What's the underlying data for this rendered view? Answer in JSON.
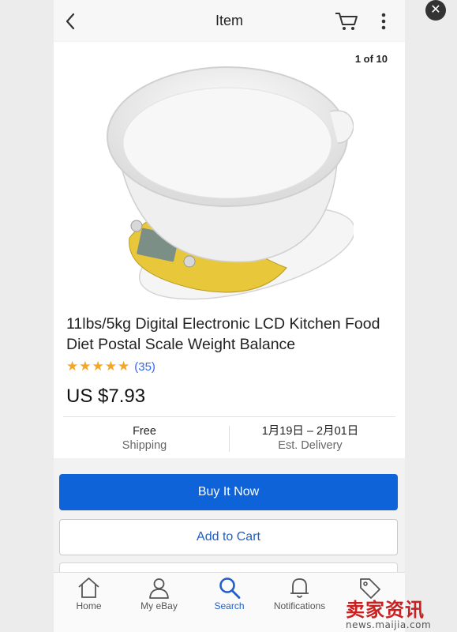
{
  "overlay": {
    "close_icon": "close-icon"
  },
  "header": {
    "title": "Item",
    "back_icon": "chevron-left-icon",
    "cart_icon": "cart-icon",
    "more_icon": "more-vertical-icon"
  },
  "gallery": {
    "counter": "1 of 10"
  },
  "product": {
    "title": "11lbs/5kg Digital Electronic LCD Kitchen Food Diet Postal Scale Weight Balance",
    "rating_stars": 5,
    "rating_count": "(35)",
    "price": "US $7.93",
    "shipping_value": "Free",
    "shipping_label": "Shipping",
    "delivery_value": "1月19日 – 2月01日",
    "delivery_label": "Est. Delivery"
  },
  "actions": {
    "buy_now": "Buy It Now",
    "add_to_cart": "Add to Cart"
  },
  "tabs": [
    {
      "label": "Home",
      "icon": "home-icon"
    },
    {
      "label": "My eBay",
      "icon": "user-icon"
    },
    {
      "label": "Search",
      "icon": "search-icon",
      "active": true
    },
    {
      "label": "Notifications",
      "icon": "bell-icon"
    },
    {
      "label": "",
      "icon": "tag-icon"
    }
  ],
  "watermark": {
    "text": "卖家资讯",
    "url": "news.maijia.com"
  },
  "colors": {
    "accent": "#0f63d9",
    "link": "#3665f3",
    "star": "#f5a623"
  }
}
